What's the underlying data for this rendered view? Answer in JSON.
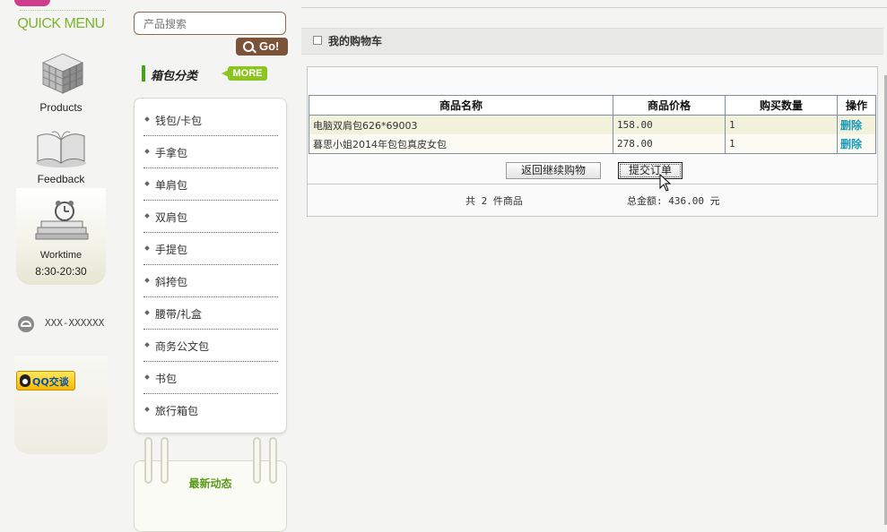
{
  "quick_menu": {
    "title": "QUICK MENU",
    "products_label": "Products",
    "feedback_label": "Feedback",
    "worktime_label": "Worktime",
    "worktime_hours": "8:30-20:30",
    "phone": "XXX-XXXXXX",
    "qq_button_label": "QQ交谈"
  },
  "sidebar": {
    "search_placeholder": "产品搜索",
    "go_label": "Go!",
    "category_title": "箱包分类",
    "more_label": "MORE",
    "categories": [
      "钱包/卡包",
      "手拿包",
      "单肩包",
      "双肩包",
      "手提包",
      "斜挎包",
      "腰带/礼盒",
      "商务公文包",
      "书包",
      "旅行箱包"
    ],
    "news_title": "最新动态"
  },
  "cart": {
    "header_title": "我的购物车",
    "columns": [
      "商品名称",
      "商品价格",
      "购买数量",
      "操作"
    ],
    "rows": [
      {
        "name": "电脑双肩包626*69003",
        "price": "158.00",
        "qty": "1",
        "action": "删除"
      },
      {
        "name": "暮思小姐2014年包包真皮女包",
        "price": "278.00",
        "qty": "1",
        "action": "删除"
      }
    ],
    "back_button": "返回继续购物",
    "submit_button": "提交订单",
    "count_text": "共 2 件商品",
    "total_text": "总金额: 436.00 元"
  },
  "colors": {
    "accent_green": "#7cb42a",
    "go_brown": "#7a5338",
    "delete_link": "#1a9ab8",
    "row_highlight": "#f1f1dc"
  }
}
